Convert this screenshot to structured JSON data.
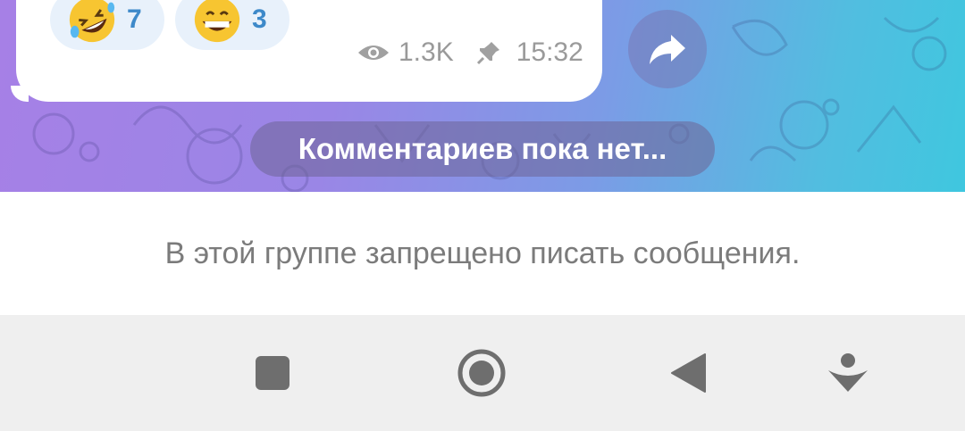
{
  "message": {
    "reactions": [
      {
        "icon": "rolling-laughing-emoji",
        "count": "7"
      },
      {
        "icon": "grinning-emoji",
        "count": "3"
      }
    ],
    "views": "1.3K",
    "time": "15:32"
  },
  "comments_pill": "Комментариев пока нет...",
  "restriction_text": "В этой группе запрещено писать сообщения.",
  "colors": {
    "bg_gradient_start": "#a680e6",
    "bg_gradient_end": "#3fc7df",
    "reaction_bg": "#e8f1fb",
    "reaction_count": "#3d89c9",
    "meta_text": "#9a9a9a",
    "nav_icon": "#6e6e6e"
  },
  "navbar": {
    "buttons": [
      "recents-square-icon",
      "home-circle-icon",
      "back-triangle-icon",
      "assistant-icon"
    ]
  }
}
